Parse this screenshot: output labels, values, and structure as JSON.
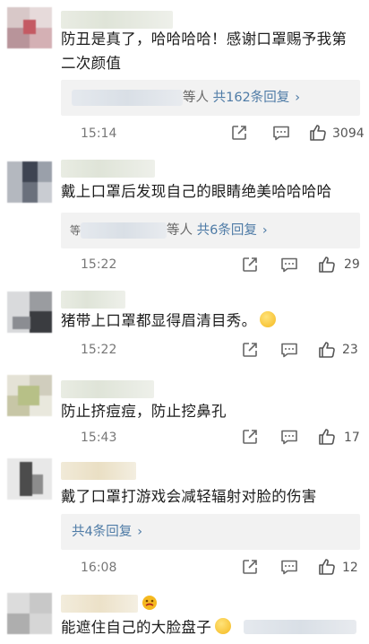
{
  "comments": [
    {
      "text": "防丑是真了，哈哈哈哈！感谢口罩赐予我第二次颜值",
      "replies_suffix": "等人",
      "replies_count": "共162条回复",
      "chevron": "›",
      "time": "15:14",
      "likes": "3094"
    },
    {
      "text": "戴上口罩后发现自己的眼睛绝美哈哈哈哈",
      "replies_prefix": "等",
      "replies_suffix": "等人",
      "replies_count": "共6条回复",
      "chevron": "›",
      "time": "15:22",
      "likes": "29"
    },
    {
      "text": "猪带上口罩都显得眉清目秀。",
      "time": "15:22",
      "likes": "23"
    },
    {
      "text": "防止挤痘痘，防止挖鼻孔",
      "time": "15:43",
      "likes": "17"
    },
    {
      "text": "戴了口罩打游戏会减轻辐射对脸的伤害",
      "replies_count": "共4条回复",
      "chevron": "›",
      "time": "16:08",
      "likes": "12"
    },
    {
      "text": "能遮住自己的大脸盘子"
    }
  ],
  "icons": {
    "share": "share-icon",
    "comment": "comment-icon",
    "like": "thumbs-up-icon"
  },
  "colors": {
    "link": "#4e7ba6",
    "time": "#777777",
    "text": "#1c1c1c"
  }
}
